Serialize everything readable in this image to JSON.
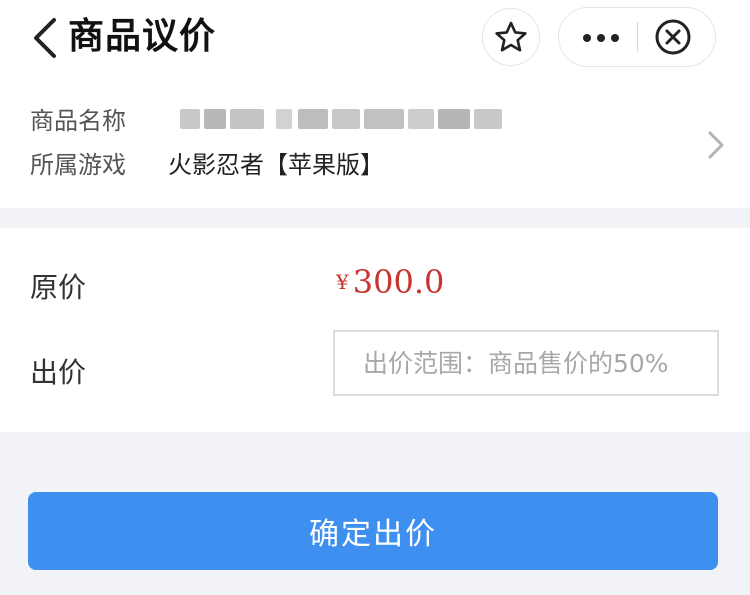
{
  "header": {
    "title": "商品议价",
    "icons": {
      "back": "chevron-left-icon",
      "favorite": "star-icon",
      "more": "more-dots-icon",
      "close": "close-circle-icon"
    }
  },
  "product": {
    "name_label": "商品名称",
    "game_label": "所属游戏",
    "game_value": "火影忍者【苹果版】"
  },
  "offer": {
    "original_price_label": "原价",
    "currency_symbol": "¥",
    "original_price": "300.0",
    "bid_label": "出价",
    "bid_placeholder": "出价范围：商品售价的50%",
    "bid_value": ""
  },
  "actions": {
    "confirm_label": "确定出价"
  },
  "colors": {
    "accent": "#3d8ff0",
    "price": "#c8342f",
    "background": "#f2f3f7"
  }
}
